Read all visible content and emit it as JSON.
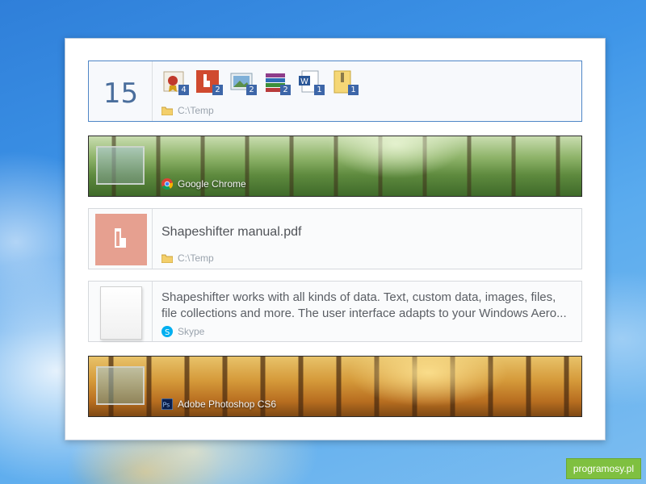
{
  "cards": {
    "files": {
      "count": "15",
      "icons": [
        {
          "name": "award-file-icon",
          "badge": "4"
        },
        {
          "name": "pdf-file-icon",
          "badge": "2"
        },
        {
          "name": "image-file-icon",
          "badge": "2"
        },
        {
          "name": "archive-file-icon",
          "badge": "2"
        },
        {
          "name": "word-file-icon",
          "badge": "1"
        },
        {
          "name": "zip-folder-icon",
          "badge": "1"
        }
      ],
      "source": "C:\\Temp"
    },
    "chrome_image": {
      "source": "Google Chrome"
    },
    "pdf": {
      "title": "Shapeshifter manual.pdf",
      "source": "C:\\Temp"
    },
    "text": {
      "line1": "Shapeshifter works with all kinds of data. Text, custom data, images, files,",
      "line2": "file collections and more. The user interface adapts to your Windows Aero...",
      "source": "Skype"
    },
    "photoshop_image": {
      "source": "Adobe Photoshop CS6"
    }
  },
  "watermark": "programosy.pl",
  "colors": {
    "accent": "#4a6e9c",
    "badge": "#3d66a8",
    "pdf_thumb": "#e6a090"
  }
}
